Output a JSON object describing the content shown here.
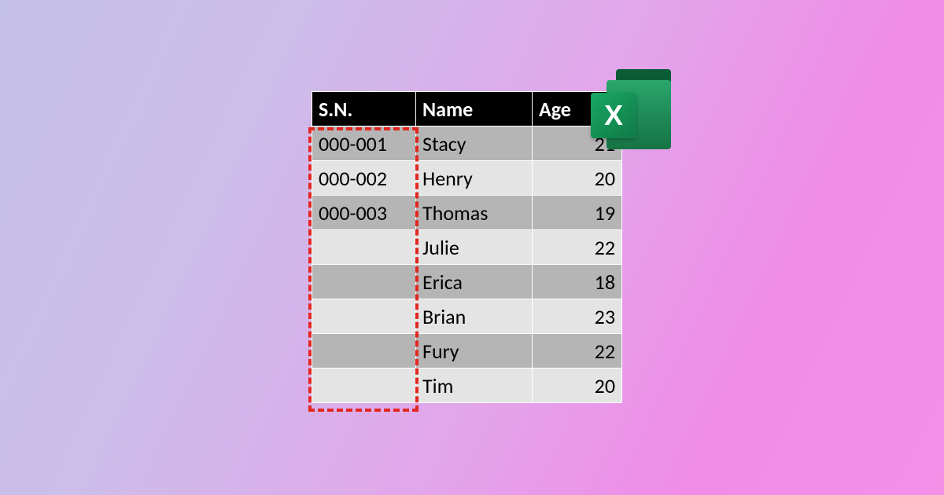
{
  "table": {
    "headers": {
      "sn": "S.N.",
      "name": "Name",
      "age": "Age"
    },
    "rows": [
      {
        "sn": "000-001",
        "name": "Stacy",
        "age": "21"
      },
      {
        "sn": "000-002",
        "name": "Henry",
        "age": "20"
      },
      {
        "sn": "000-003",
        "name": "Thomas",
        "age": "19"
      },
      {
        "sn": "",
        "name": "Julie",
        "age": "22"
      },
      {
        "sn": "",
        "name": "Erica",
        "age": "18"
      },
      {
        "sn": "",
        "name": "Brian",
        "age": "23"
      },
      {
        "sn": "",
        "name": "Fury",
        "age": "22"
      },
      {
        "sn": "",
        "name": "Tim",
        "age": "20"
      }
    ]
  },
  "icon": {
    "letter": "X"
  }
}
